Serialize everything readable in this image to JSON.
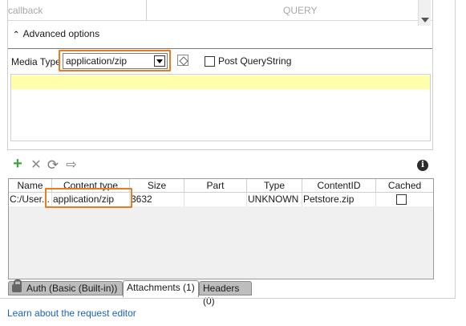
{
  "params": {
    "name": "callback",
    "style": "QUERY"
  },
  "advanced": {
    "label": "Advanced options"
  },
  "media_type": {
    "label": "Media Type",
    "value": "application/zip"
  },
  "post_querystring": {
    "label": "Post QueryString",
    "checked": false
  },
  "attachments_table": {
    "columns": [
      "Name",
      "Content type",
      "Size",
      "Part",
      "Type",
      "ContentID",
      "Cached"
    ],
    "rows": [
      {
        "name": "C:/User...",
        "content_type": "application/zip",
        "size": "3632",
        "part": "",
        "type": "UNKNOWN",
        "content_id": "Petstore.zip",
        "cached": false
      }
    ]
  },
  "tabs": [
    {
      "label": "Auth (Basic (Built-in))",
      "active": false
    },
    {
      "label": "Attachments (1)",
      "active": true
    },
    {
      "label": "Headers (0)",
      "active": false
    }
  ],
  "footer": {
    "link": "Learn about the request editor"
  },
  "colors": {
    "highlight": "#ea7b22",
    "link": "#1c62b9",
    "add_icon": "#3aa53a",
    "editor_line": "#ffffaa"
  },
  "icons": {
    "add": "plus-icon",
    "remove": "close-icon",
    "reload": "refresh-icon",
    "export": "export-icon",
    "info": "info-icon",
    "auth": "lock-icon"
  }
}
